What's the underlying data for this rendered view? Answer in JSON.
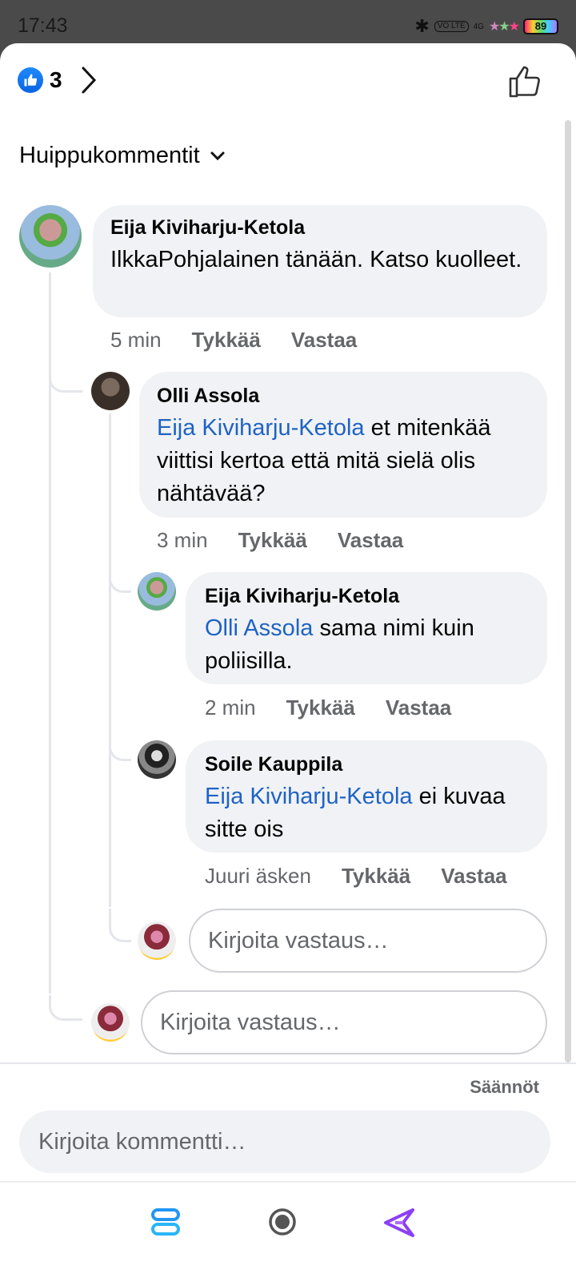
{
  "status_bar": {
    "time": "17:43",
    "network_label": "VO LTE",
    "signal_label": "4G",
    "battery": "89"
  },
  "header": {
    "like_count": "3"
  },
  "sort": {
    "label": "Huippukommentit"
  },
  "comments": [
    {
      "author": "Eija Kiviharju-Ketola",
      "mention": "",
      "text": "IlkkaPohjalainen tänään. Katso kuolleet.",
      "time": "5 min",
      "like": "Tykkää",
      "reply": "Vastaa"
    },
    {
      "author": "Olli Assola",
      "mention": "Eija Kiviharju-Ketola",
      "text": " et mitenkää viittisi kertoa että mitä sielä olis nähtävää?",
      "time": "3 min",
      "like": "Tykkää",
      "reply": "Vastaa"
    },
    {
      "author": "Eija Kiviharju-Ketola",
      "mention": "Olli Assola",
      "text": " sama nimi kuin poliisilla.",
      "time": "2 min",
      "like": "Tykkää",
      "reply": "Vastaa"
    },
    {
      "author": "Soile Kauppila",
      "mention": "Eija Kiviharju-Ketola",
      "text": " ei kuvaa sitte ois",
      "time": "Juuri äsken",
      "like": "Tykkää",
      "reply": "Vastaa"
    }
  ],
  "reply_placeholder": "Kirjoita vastaus…",
  "footer": {
    "rules": "Säännöt",
    "comment_placeholder": "Kirjoita kommentti…"
  },
  "icons": {
    "like_badge": "like-thumb-icon",
    "like_button": "thumbs-up-outline-icon",
    "nav": [
      "recent-apps-icon",
      "home-icon",
      "back-icon"
    ]
  },
  "colors": {
    "accent": "#1f63c4",
    "bubble": "#f0f2f5",
    "meta": "#65676b"
  }
}
